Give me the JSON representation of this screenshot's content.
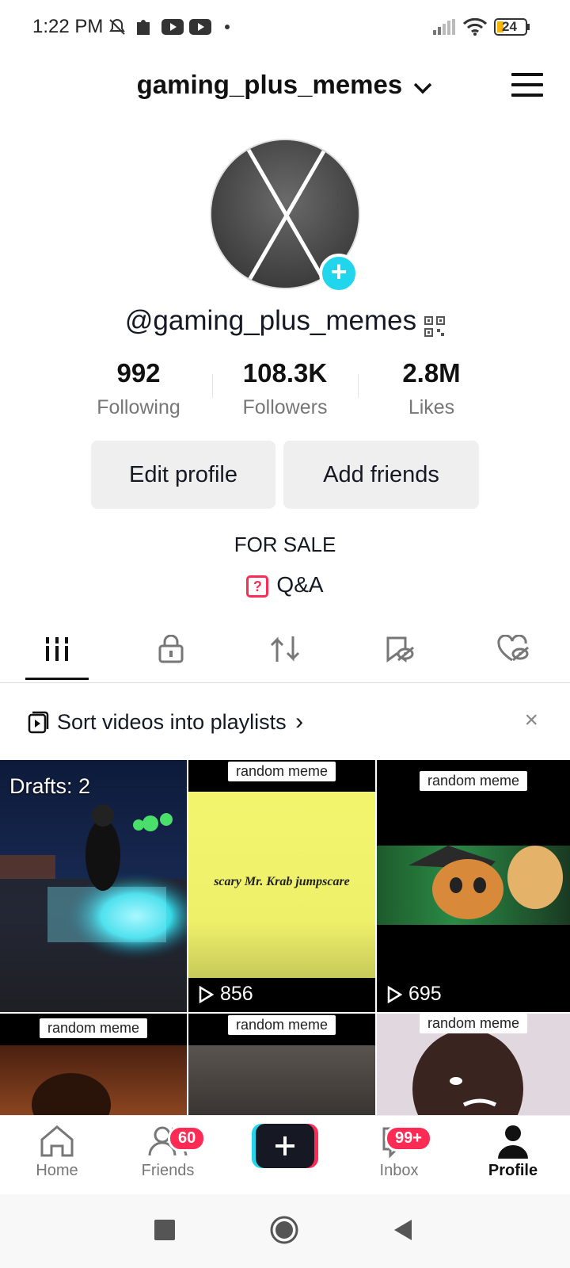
{
  "status_bar": {
    "time": "1:22 PM",
    "battery": "24",
    "icons": [
      "silent-bell-icon",
      "puzzle-icon",
      "youtube-icon",
      "youtube-icon",
      "dot-icon",
      "signal-icon",
      "wifi-icon",
      "battery-icon"
    ]
  },
  "header": {
    "title": "gaming_plus_memes"
  },
  "profile": {
    "handle": "@gaming_plus_memes",
    "stats": [
      {
        "value": "992",
        "label": "Following"
      },
      {
        "value": "108.3K",
        "label": "Followers"
      },
      {
        "value": "2.8M",
        "label": "Likes"
      }
    ],
    "buttons": {
      "edit": "Edit profile",
      "add_friends": "Add friends"
    },
    "bio": "FOR SALE",
    "qa_label": "Q&A"
  },
  "tabs": [
    "videos-grid-icon",
    "private-lock-icon",
    "repost-icon",
    "favorites-icon",
    "liked-heart-icon"
  ],
  "playlist_banner": {
    "text": "Sort videos into playlists",
    "chevron": "›",
    "close": "×"
  },
  "grid": {
    "drafts_label": "Drafts: 2",
    "cells": [
      {
        "label": "",
        "views": ""
      },
      {
        "label": "random meme",
        "views": "856",
        "caption": "scary Mr. Krab jumpscare"
      },
      {
        "label": "random meme",
        "views": "695"
      },
      {
        "label": "random meme",
        "views": ""
      },
      {
        "label": "random meme",
        "views": ""
      },
      {
        "label": "random meme",
        "views": ""
      }
    ]
  },
  "bottom_nav": {
    "home": "Home",
    "friends": "Friends",
    "friends_badge": "60",
    "inbox": "Inbox",
    "inbox_badge": "99+",
    "profile": "Profile"
  },
  "colors": {
    "accent_red": "#fe2c55",
    "accent_cyan": "#20d5ec"
  }
}
